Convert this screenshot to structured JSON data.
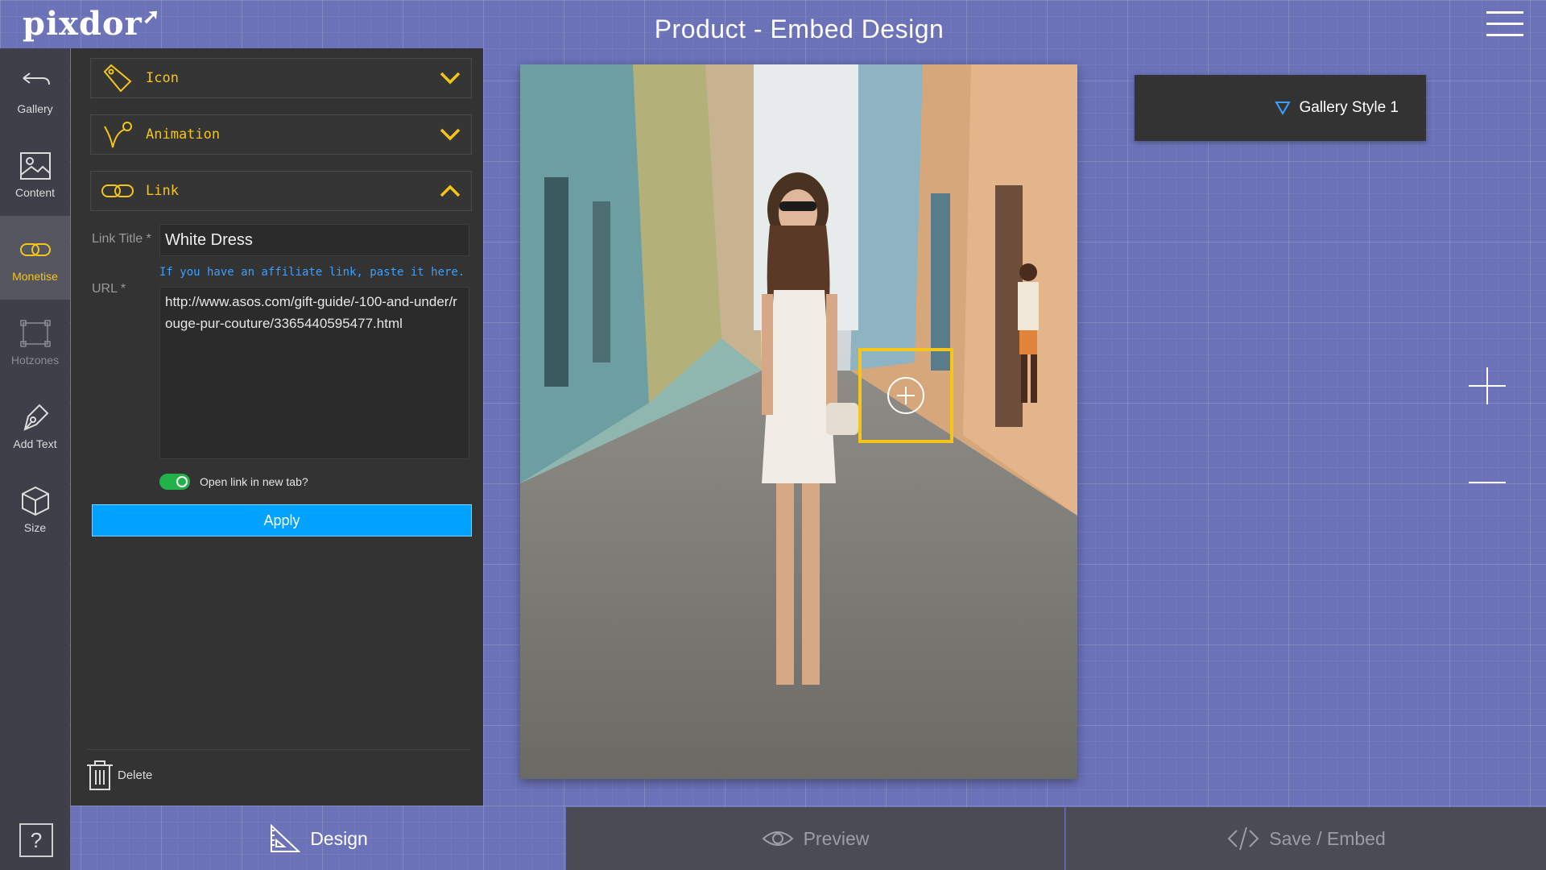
{
  "app": {
    "logo": "pixdor",
    "page_title": "Product - Embed Design"
  },
  "left_nav": {
    "items": [
      {
        "label": "Gallery",
        "icon": "back-arrow-icon"
      },
      {
        "label": "Content",
        "icon": "image-icon"
      },
      {
        "label": "Monetise",
        "icon": "link-icon",
        "active": true
      },
      {
        "label": "Hotzones",
        "icon": "hotzone-icon",
        "disabled": true
      },
      {
        "label": "Add Text",
        "icon": "pen-icon"
      },
      {
        "label": "Size",
        "icon": "cube-icon"
      }
    ],
    "help": "?"
  },
  "panel": {
    "accordions": [
      {
        "label": "Icon",
        "icon": "tag-icon",
        "state": "collapsed"
      },
      {
        "label": "Animation",
        "icon": "animation-icon",
        "state": "collapsed"
      },
      {
        "label": "Link",
        "icon": "link-icon",
        "state": "expanded"
      }
    ],
    "link_title_label": "Link Title *",
    "link_title_value": "White Dress",
    "affiliate_hint": "If you have an affiliate link, paste it here.",
    "url_label": "URL *",
    "url_value": "http://www.asos.com/gift-guide/-100-and-under/rouge-pur-couture/3365440595477.html",
    "open_new_tab_label": "Open link in new tab?",
    "open_new_tab": true,
    "apply_label": "Apply",
    "delete_label": "Delete"
  },
  "gallery_style": {
    "value": "Gallery Style 1"
  },
  "tabs": [
    {
      "label": "Design",
      "icon": "set-square-icon",
      "active": true
    },
    {
      "label": "Preview",
      "icon": "eye-icon"
    },
    {
      "label": "Save / Embed",
      "icon": "code-icon"
    }
  ],
  "colors": {
    "accent": "#f5c518",
    "primary_button": "#00a2ff",
    "toggle_on": "#21b24b",
    "background": "#6b72b8",
    "panel": "#333333"
  }
}
